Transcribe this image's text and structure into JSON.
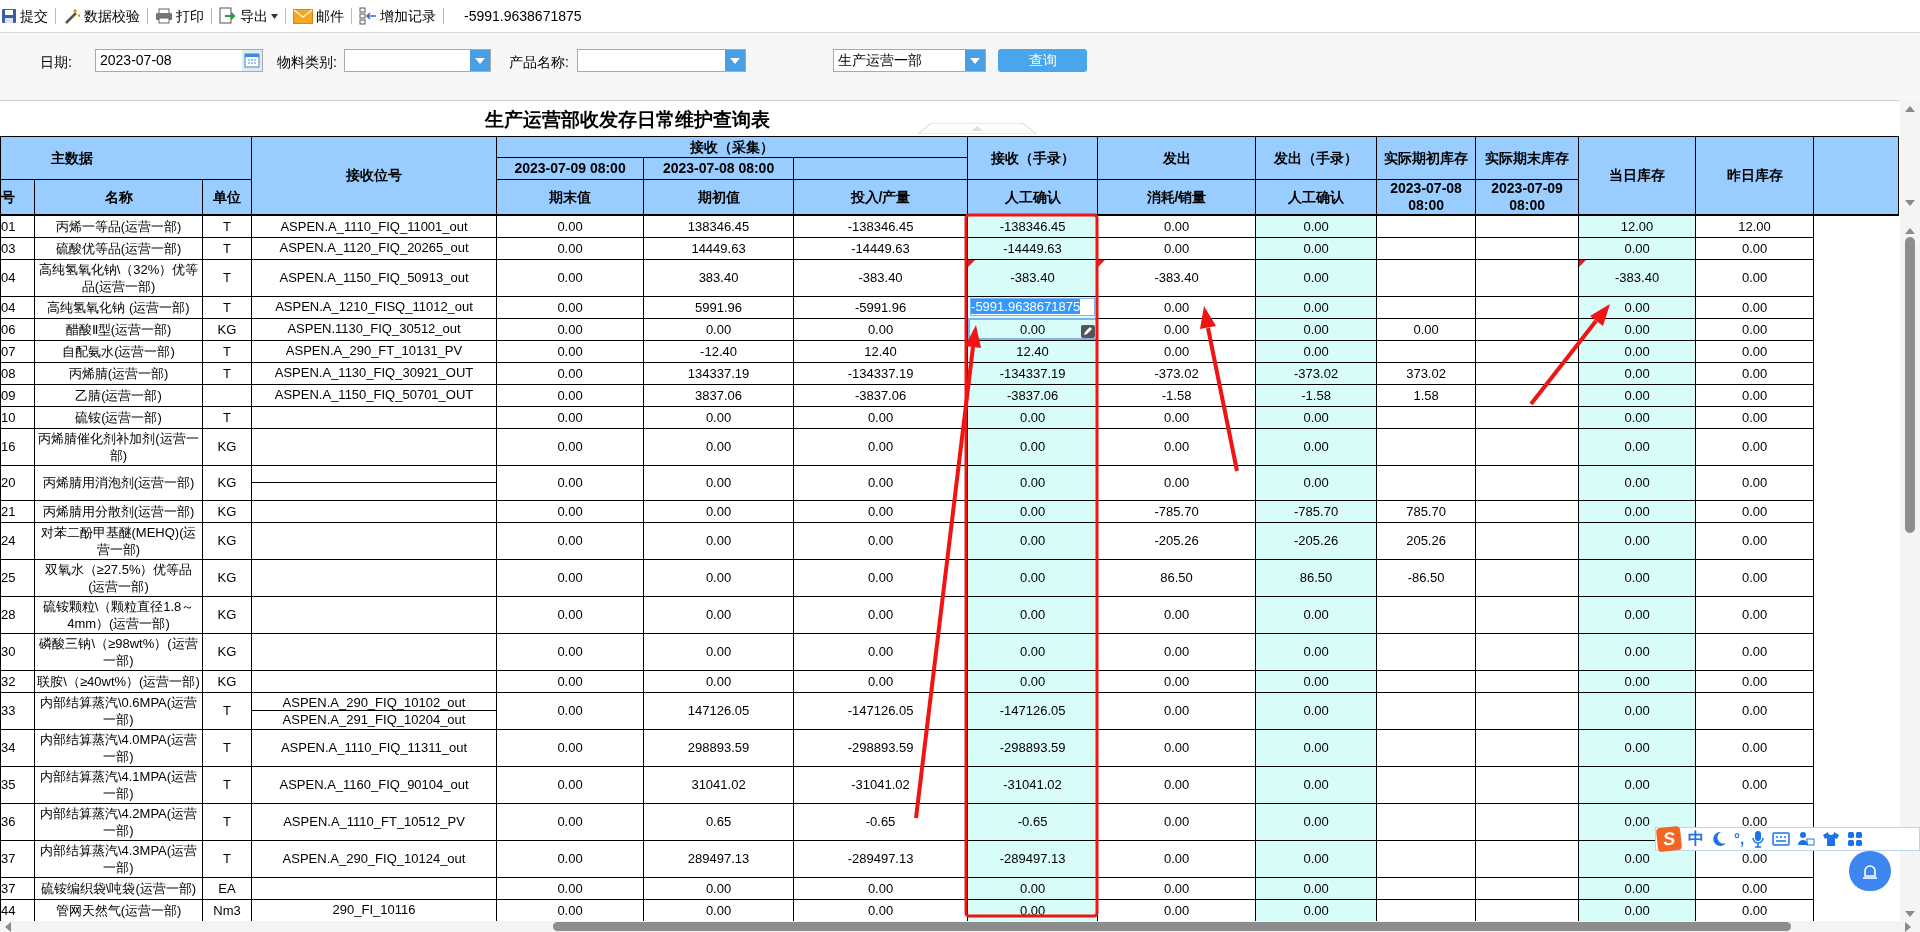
{
  "toolbar": {
    "items": [
      {
        "label": "提交",
        "dropdown": false
      },
      {
        "label": "数据校验",
        "dropdown": false
      },
      {
        "label": "打印",
        "dropdown": false
      },
      {
        "label": "导出",
        "dropdown": true
      },
      {
        "label": "邮件",
        "dropdown": false
      },
      {
        "label": "增加记录",
        "dropdown": false
      }
    ],
    "value": "-5991.9638671875"
  },
  "filters": {
    "date": {
      "label": "日期:",
      "value": "2023-07-08"
    },
    "material_category": {
      "label": "物料类别:"
    },
    "product_name": {
      "label": "产品名称:"
    },
    "department": {
      "value": "生产运营一部"
    },
    "query_button": "查询"
  },
  "table": {
    "title": "生产运营部收发存日常维护查询表",
    "header": {
      "master": "主数据",
      "tag": "接收位号",
      "collect": "接收（采集）",
      "collect_end_date": "2023-07-09 08:00",
      "collect_begin_date": "2023-07-08 08:00",
      "recv_manual": "接收（手录）",
      "send": "发出",
      "send_manual": "发出（手录）",
      "actual_begin": "实际期初库存",
      "actual_end": "实际期末库存",
      "today": "当日库存",
      "yesterday": "昨日库存",
      "code": "号",
      "name": "名称",
      "unit": "单位",
      "end": "期末值",
      "begin": "期初值",
      "input": "投入/产量",
      "recv_confirm": "人工确认",
      "consume": "消耗/销量",
      "send_confirm": "人工确认",
      "actual_begin_date": "2023-07-08 08:00",
      "actual_end_date": "2023-07-09 08:00"
    },
    "rows": [
      {
        "cells": [
          "01",
          "丙烯一等品(运营一部)",
          "T",
          "0.00",
          "138346.45",
          "-138346.45",
          "-138346.45",
          "0.00",
          "0.00",
          null,
          null,
          "12.00",
          "12.00"
        ],
        "tags": [
          "ASPEN.A_1110_FIQ_11001_out"
        ]
      },
      {
        "cells": [
          "03",
          "硫酸优等品(运营一部)",
          "T",
          "0.00",
          "14449.63",
          "-14449.63",
          "-14449.63",
          "0.00",
          "0.00",
          null,
          null,
          "0.00",
          "0.00"
        ],
        "tags": [
          "ASPEN.A_1120_FIQ_20265_out"
        ]
      },
      {
        "cells": [
          "04",
          "高纯氢氧化钠\\（32%）优等品(运营一部)",
          "T",
          "0.00",
          "383.40",
          "-383.40",
          "-383.40",
          "-383.40",
          "0.00",
          null,
          null,
          "-383.40",
          "0.00"
        ],
        "tags": [
          "ASPEN.A_1150_FIQ_50913_out"
        ],
        "recv_manual_marked": true,
        "consume_marked": true,
        "today_marked": true
      },
      {
        "cells": [
          "04",
          "高纯氢氧化钠 (运营一部)",
          "T",
          "0.00",
          "5991.96",
          "-5991.96",
          "-5991.9638671875",
          "0.00",
          "0.00",
          null,
          null,
          "0.00",
          "0.00"
        ],
        "tags": [
          "ASPEN.A_1210_FISQ_11012_out"
        ],
        "recv_manual_editing": true
      },
      {
        "cells": [
          "06",
          "醋酸Ⅱ型(运营一部)",
          "KG",
          "0.00",
          "0.00",
          "0.00",
          "0.00",
          "0.00",
          "0.00",
          "0.00",
          null,
          "0.00",
          "0.00"
        ],
        "tags": [
          "ASPEN.1130_FIQ_30512_out"
        ],
        "recv_manual_focused": true
      },
      {
        "cells": [
          "07",
          "自配氨水(运营一部)",
          "T",
          "0.00",
          "-12.40",
          "12.40",
          "12.40",
          "0.00",
          "0.00",
          null,
          null,
          "0.00",
          "0.00"
        ],
        "tags": [
          "ASPEN.A_290_FT_10131_PV"
        ]
      },
      {
        "cells": [
          "08",
          "丙烯腈(运营一部)",
          "T",
          "0.00",
          "134337.19",
          "-134337.19",
          "-134337.19",
          "-373.02",
          "-373.02",
          "373.02",
          null,
          "0.00",
          "0.00"
        ],
        "tags": [
          "ASPEN.A_1130_FIQ_30921_OUT"
        ]
      },
      {
        "cells": [
          "09",
          "乙腈(运营一部)",
          null,
          "0.00",
          "3837.06",
          "-3837.06",
          "-3837.06",
          "-1.58",
          "-1.58",
          "1.58",
          null,
          "0.00",
          "0.00"
        ],
        "tags": [
          "ASPEN.A_1150_FIQ_50701_OUT"
        ]
      },
      {
        "cells": [
          "10",
          "硫铵(运营一部)",
          "T",
          "0.00",
          "0.00",
          "0.00",
          "0.00",
          "0.00",
          "0.00",
          null,
          null,
          "0.00",
          "0.00"
        ]
      },
      {
        "cells": [
          "16",
          "丙烯腈催化剂补加剂(运营一部)",
          "KG",
          "0.00",
          "0.00",
          "0.00",
          "0.00",
          "0.00",
          "0.00",
          null,
          null,
          "0.00",
          "0.00"
        ]
      },
      {
        "cells": [
          "20",
          "丙烯腈用消泡剂(运营一部)",
          "KG",
          "0.00",
          "0.00",
          "0.00",
          "0.00",
          "0.00",
          "0.00",
          null,
          null,
          "0.00",
          "0.00"
        ],
        "split_tag": true
      },
      {
        "cells": [
          "21",
          "丙烯腈用分散剂(运营一部)",
          "KG",
          "0.00",
          "0.00",
          "0.00",
          "0.00",
          "-785.70",
          "-785.70",
          "785.70",
          null,
          "0.00",
          "0.00"
        ]
      },
      {
        "cells": [
          "24",
          "对苯二酚甲基醚(MEHQ)(运营一部)",
          "KG",
          "0.00",
          "0.00",
          "0.00",
          "0.00",
          "-205.26",
          "-205.26",
          "205.26",
          null,
          "0.00",
          "0.00"
        ]
      },
      {
        "cells": [
          "25",
          "双氧水（≥27.5%）优等品(运营一部)",
          "KG",
          "0.00",
          "0.00",
          "0.00",
          "0.00",
          "86.50",
          "86.50",
          "-86.50",
          null,
          "0.00",
          "0.00"
        ]
      },
      {
        "cells": [
          "28",
          "硫铵颗粒\\（颗粒直径1.8～4mm）(运营一部)",
          "KG",
          "0.00",
          "0.00",
          "0.00",
          "0.00",
          "0.00",
          "0.00",
          null,
          null,
          "0.00",
          "0.00"
        ]
      },
      {
        "cells": [
          "30",
          "磷酸三钠\\（≥98wt%）(运营一部)",
          "KG",
          "0.00",
          "0.00",
          "0.00",
          "0.00",
          "0.00",
          "0.00",
          null,
          null,
          "0.00",
          "0.00"
        ]
      },
      {
        "cells": [
          "32",
          "联胺\\（≥40wt%）(运营一部)",
          "KG",
          "0.00",
          "0.00",
          "0.00",
          "0.00",
          "0.00",
          "0.00",
          null,
          null,
          "0.00",
          "0.00"
        ]
      },
      {
        "cells": [
          "33",
          "内部结算蒸汽\\0.6MPA(运营一部)",
          "T",
          "0.00",
          "147126.05",
          "-147126.05",
          "-147126.05",
          "0.00",
          "0.00",
          null,
          null,
          "0.00",
          "0.00"
        ],
        "tags": [
          "ASPEN.A_290_FIQ_10102_out",
          "ASPEN.A_291_FIQ_10204_out"
        ],
        "split_tag": true
      },
      {
        "cells": [
          "34",
          "内部结算蒸汽\\4.0MPA(运营一部)",
          "T",
          "0.00",
          "298893.59",
          "-298893.59",
          "-298893.59",
          "0.00",
          "0.00",
          null,
          null,
          "0.00",
          "0.00"
        ],
        "tags": [
          "ASPEN.A_1110_FIQ_11311_out"
        ]
      },
      {
        "cells": [
          "35",
          "内部结算蒸汽\\4.1MPA(运营一部)",
          "T",
          "0.00",
          "31041.02",
          "-31041.02",
          "-31041.02",
          "0.00",
          "0.00",
          null,
          null,
          "0.00",
          "0.00"
        ],
        "tags": [
          "ASPEN.A_1160_FIQ_90104_out"
        ]
      },
      {
        "cells": [
          "36",
          "内部结算蒸汽\\4.2MPA(运营一部)",
          "T",
          "0.00",
          "0.65",
          "-0.65",
          "-0.65",
          "0.00",
          "0.00",
          null,
          null,
          "0.00",
          "0.00"
        ],
        "tags": [
          "ASPEN.A_1110_FT_10512_PV"
        ]
      },
      {
        "cells": [
          "37",
          "内部结算蒸汽\\4.3MPA(运营一部)",
          "T",
          "0.00",
          "289497.13",
          "-289497.13",
          "-289497.13",
          "0.00",
          "0.00",
          null,
          null,
          "0.00",
          "0.00"
        ],
        "tags": [
          "ASPEN.A_290_FIQ_10124_out"
        ]
      },
      {
        "cells": [
          "37",
          "硫铵编织袋\\吨袋(运营一部)",
          "EA",
          "0.00",
          "0.00",
          "0.00",
          "0.00",
          "0.00",
          "0.00",
          null,
          null,
          "0.00",
          "0.00"
        ]
      },
      {
        "cells": [
          "44",
          "管网天然气(运营一部)",
          "Nm3",
          "0.00",
          "0.00",
          "0.00",
          "0.00",
          "0.00",
          "0.00",
          null,
          null,
          "0.00",
          "0.00"
        ],
        "tags": [
          "290_FI_10116"
        ]
      }
    ]
  },
  "ime_toolbar": {
    "logo": "S",
    "mode": "中",
    "punctuation": "°,"
  }
}
